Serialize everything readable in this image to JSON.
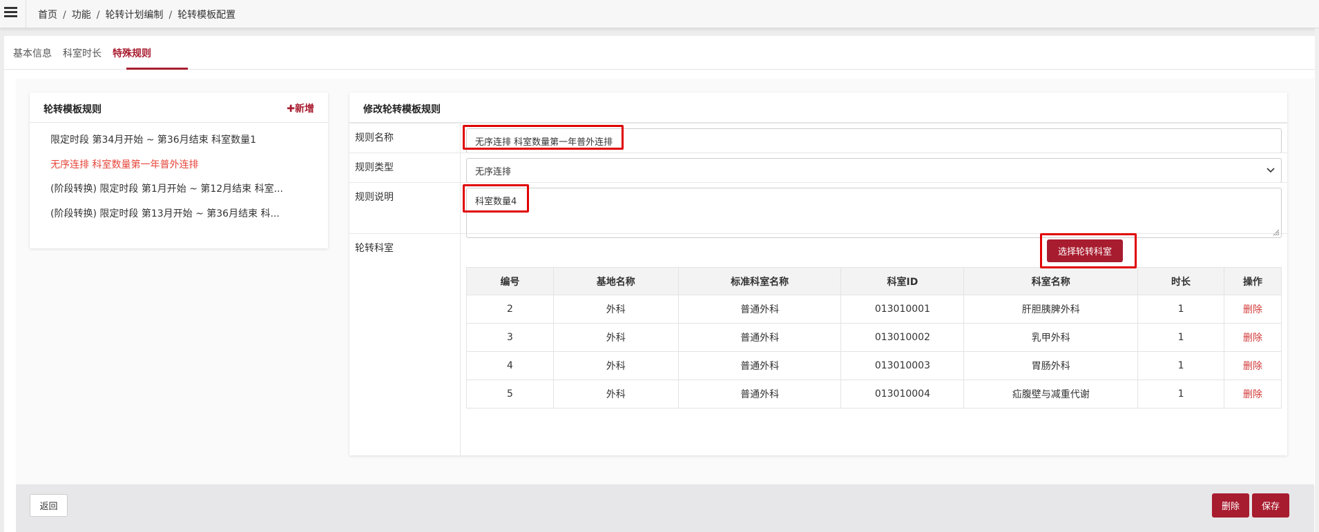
{
  "breadcrumb": [
    "首页",
    "功能",
    "轮转计划编制",
    "轮转模板配置"
  ],
  "tabs": [
    "基本信息",
    "科室时长",
    "特殊规则"
  ],
  "left_card": {
    "title": "轮转模板规则",
    "add_label": "✚新增",
    "rules": [
      "限定时段 第34月开始 ~ 第36月结束 科室数量1",
      "无序连排 科室数量第一年普外连排",
      "(阶段转换) 限定时段 第1月开始 ~ 第12月结束 科室...",
      "(阶段转换) 限定时段 第13月开始 ~ 第36月结束 科..."
    ]
  },
  "right_card": {
    "title": "修改轮转模板规则",
    "labels": {
      "rule_name": "规则名称",
      "rule_type": "规则类型",
      "rule_desc": "规则说明",
      "rotation_depts": "轮转科室"
    },
    "rule_name_value": "无序连排 科室数量第一年普外连排",
    "rule_type_value": "无序连排",
    "rule_desc_value": "科室数量4",
    "select_button": "选择轮转科室",
    "table": {
      "headers": [
        "编号",
        "基地名称",
        "标准科室名称",
        "科室ID",
        "科室名称",
        "时长",
        "操作"
      ],
      "rows": [
        [
          "2",
          "外科",
          "普通外科",
          "013010001",
          "肝胆胰脾外科",
          "1",
          "删除"
        ],
        [
          "3",
          "外科",
          "普通外科",
          "013010002",
          "乳甲外科",
          "1",
          "删除"
        ],
        [
          "4",
          "外科",
          "普通外科",
          "013010003",
          "胃肠外科",
          "1",
          "删除"
        ],
        [
          "5",
          "外科",
          "普通外科",
          "013010004",
          "疝腹壁与减重代谢",
          "1",
          "删除"
        ]
      ]
    }
  },
  "footer": {
    "back": "返回",
    "delete": "删除",
    "save": "保存"
  },
  "colors": {
    "accent": "#a81c2f",
    "active_rule": "#e6453a",
    "highlight": "#e00000"
  }
}
